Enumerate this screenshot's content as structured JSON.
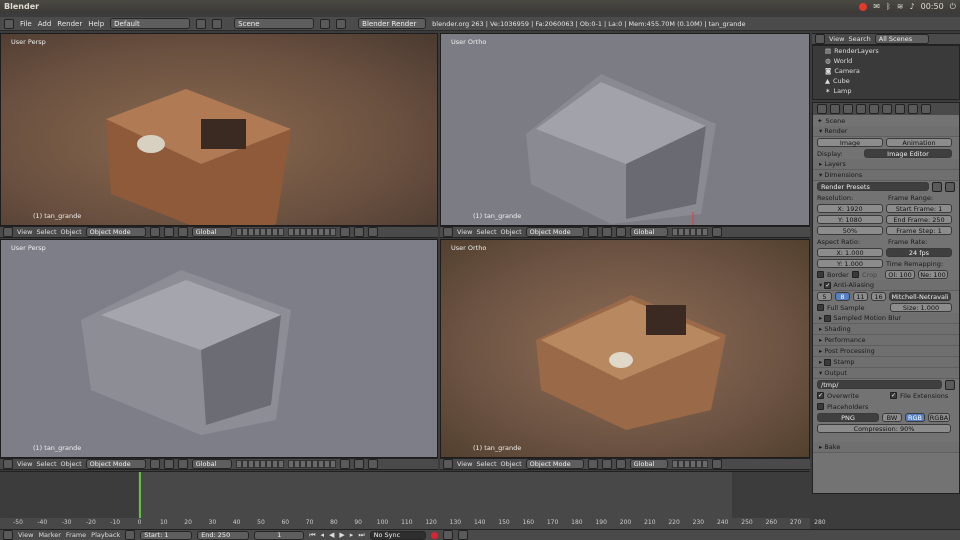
{
  "window": {
    "title": "Blender",
    "clock": "00:50"
  },
  "menubar": {
    "menus": [
      "File",
      "Add",
      "Render",
      "Help"
    ],
    "layout": "Default",
    "scene": "Scene",
    "engine": "Blender Render",
    "stats": "blender.org 263 | Ve:1036959 | Fa:2060063 | Ob:0-1 | La:0 | Mem:455.70M (0.10M) | tan_grande"
  },
  "viewports": [
    {
      "label": "User Persp",
      "object": "(1) tan_grande"
    },
    {
      "label": "User Ortho",
      "object": "(1) tan_grande"
    },
    {
      "label": "User Persp",
      "object": "(1) tan_grande"
    },
    {
      "label": "User Ortho",
      "object": "(1) tan_grande"
    }
  ],
  "viewheader": {
    "view": "View",
    "select": "Select",
    "object": "Object",
    "mode": "Object Mode",
    "orient": "Global"
  },
  "outliner": {
    "view": "View",
    "search": "Search",
    "filter": "All Scenes",
    "items": [
      "RenderLayers",
      "World",
      "Camera",
      "Cube",
      "Lamp"
    ]
  },
  "props": {
    "scene": "Scene",
    "render": "Render",
    "image": "Image",
    "animation": "Animation",
    "display_label": "Display:",
    "display_value": "Image Editor",
    "layers": "Layers",
    "dimensions": "Dimensions",
    "presets": "Render Presets",
    "resolution": "Resolution:",
    "res_x": "X: 1920",
    "res_y": "Y: 1080",
    "res_pct": "50%",
    "frame_range": "Frame Range:",
    "start": "Start Frame: 1",
    "end": "End Frame: 250",
    "step": "Frame Step: 1",
    "aspect": "Aspect Ratio:",
    "asp_x": "X: 1.000",
    "asp_y": "Y: 1.000",
    "frame_rate": "Frame Rate:",
    "fps": "24 fps",
    "border": "Border",
    "crop": "Crop",
    "remap": "Time Remapping:",
    "old": "Ol: 100",
    "new": "Ne: 100",
    "aa": "Anti-Aliasing",
    "aa_vals": [
      "5",
      "8",
      "11",
      "16"
    ],
    "filter": "Mitchell-Netravali",
    "full_sample": "Full Sample",
    "size": "Size: 1.000",
    "motion_blur": "Sampled Motion Blur",
    "shading": "Shading",
    "performance": "Performance",
    "post": "Post Processing",
    "stamp": "Stamp",
    "output": "Output",
    "path": "/tmp/",
    "overwrite": "Overwrite",
    "file_ext": "File Extensions",
    "placeholders": "Placeholders",
    "format": "PNG",
    "bw": "BW",
    "rgb": "RGB",
    "rgba": "RGBA",
    "compression": "Compression: 90%",
    "bake": "Bake"
  },
  "timeline": {
    "ticks": [
      "-50",
      "-40",
      "-30",
      "-20",
      "-10",
      "0",
      "10",
      "20",
      "30",
      "40",
      "50",
      "60",
      "70",
      "80",
      "90",
      "100",
      "110",
      "120",
      "130",
      "140",
      "150",
      "160",
      "170",
      "180",
      "190",
      "200",
      "210",
      "220",
      "230",
      "240",
      "250",
      "260",
      "270",
      "280"
    ],
    "view": "View",
    "marker": "Marker",
    "frame": "Frame",
    "playback": "Playback",
    "start": "Start: 1",
    "end": "End: 250",
    "current": "1",
    "sync": "No Sync"
  }
}
